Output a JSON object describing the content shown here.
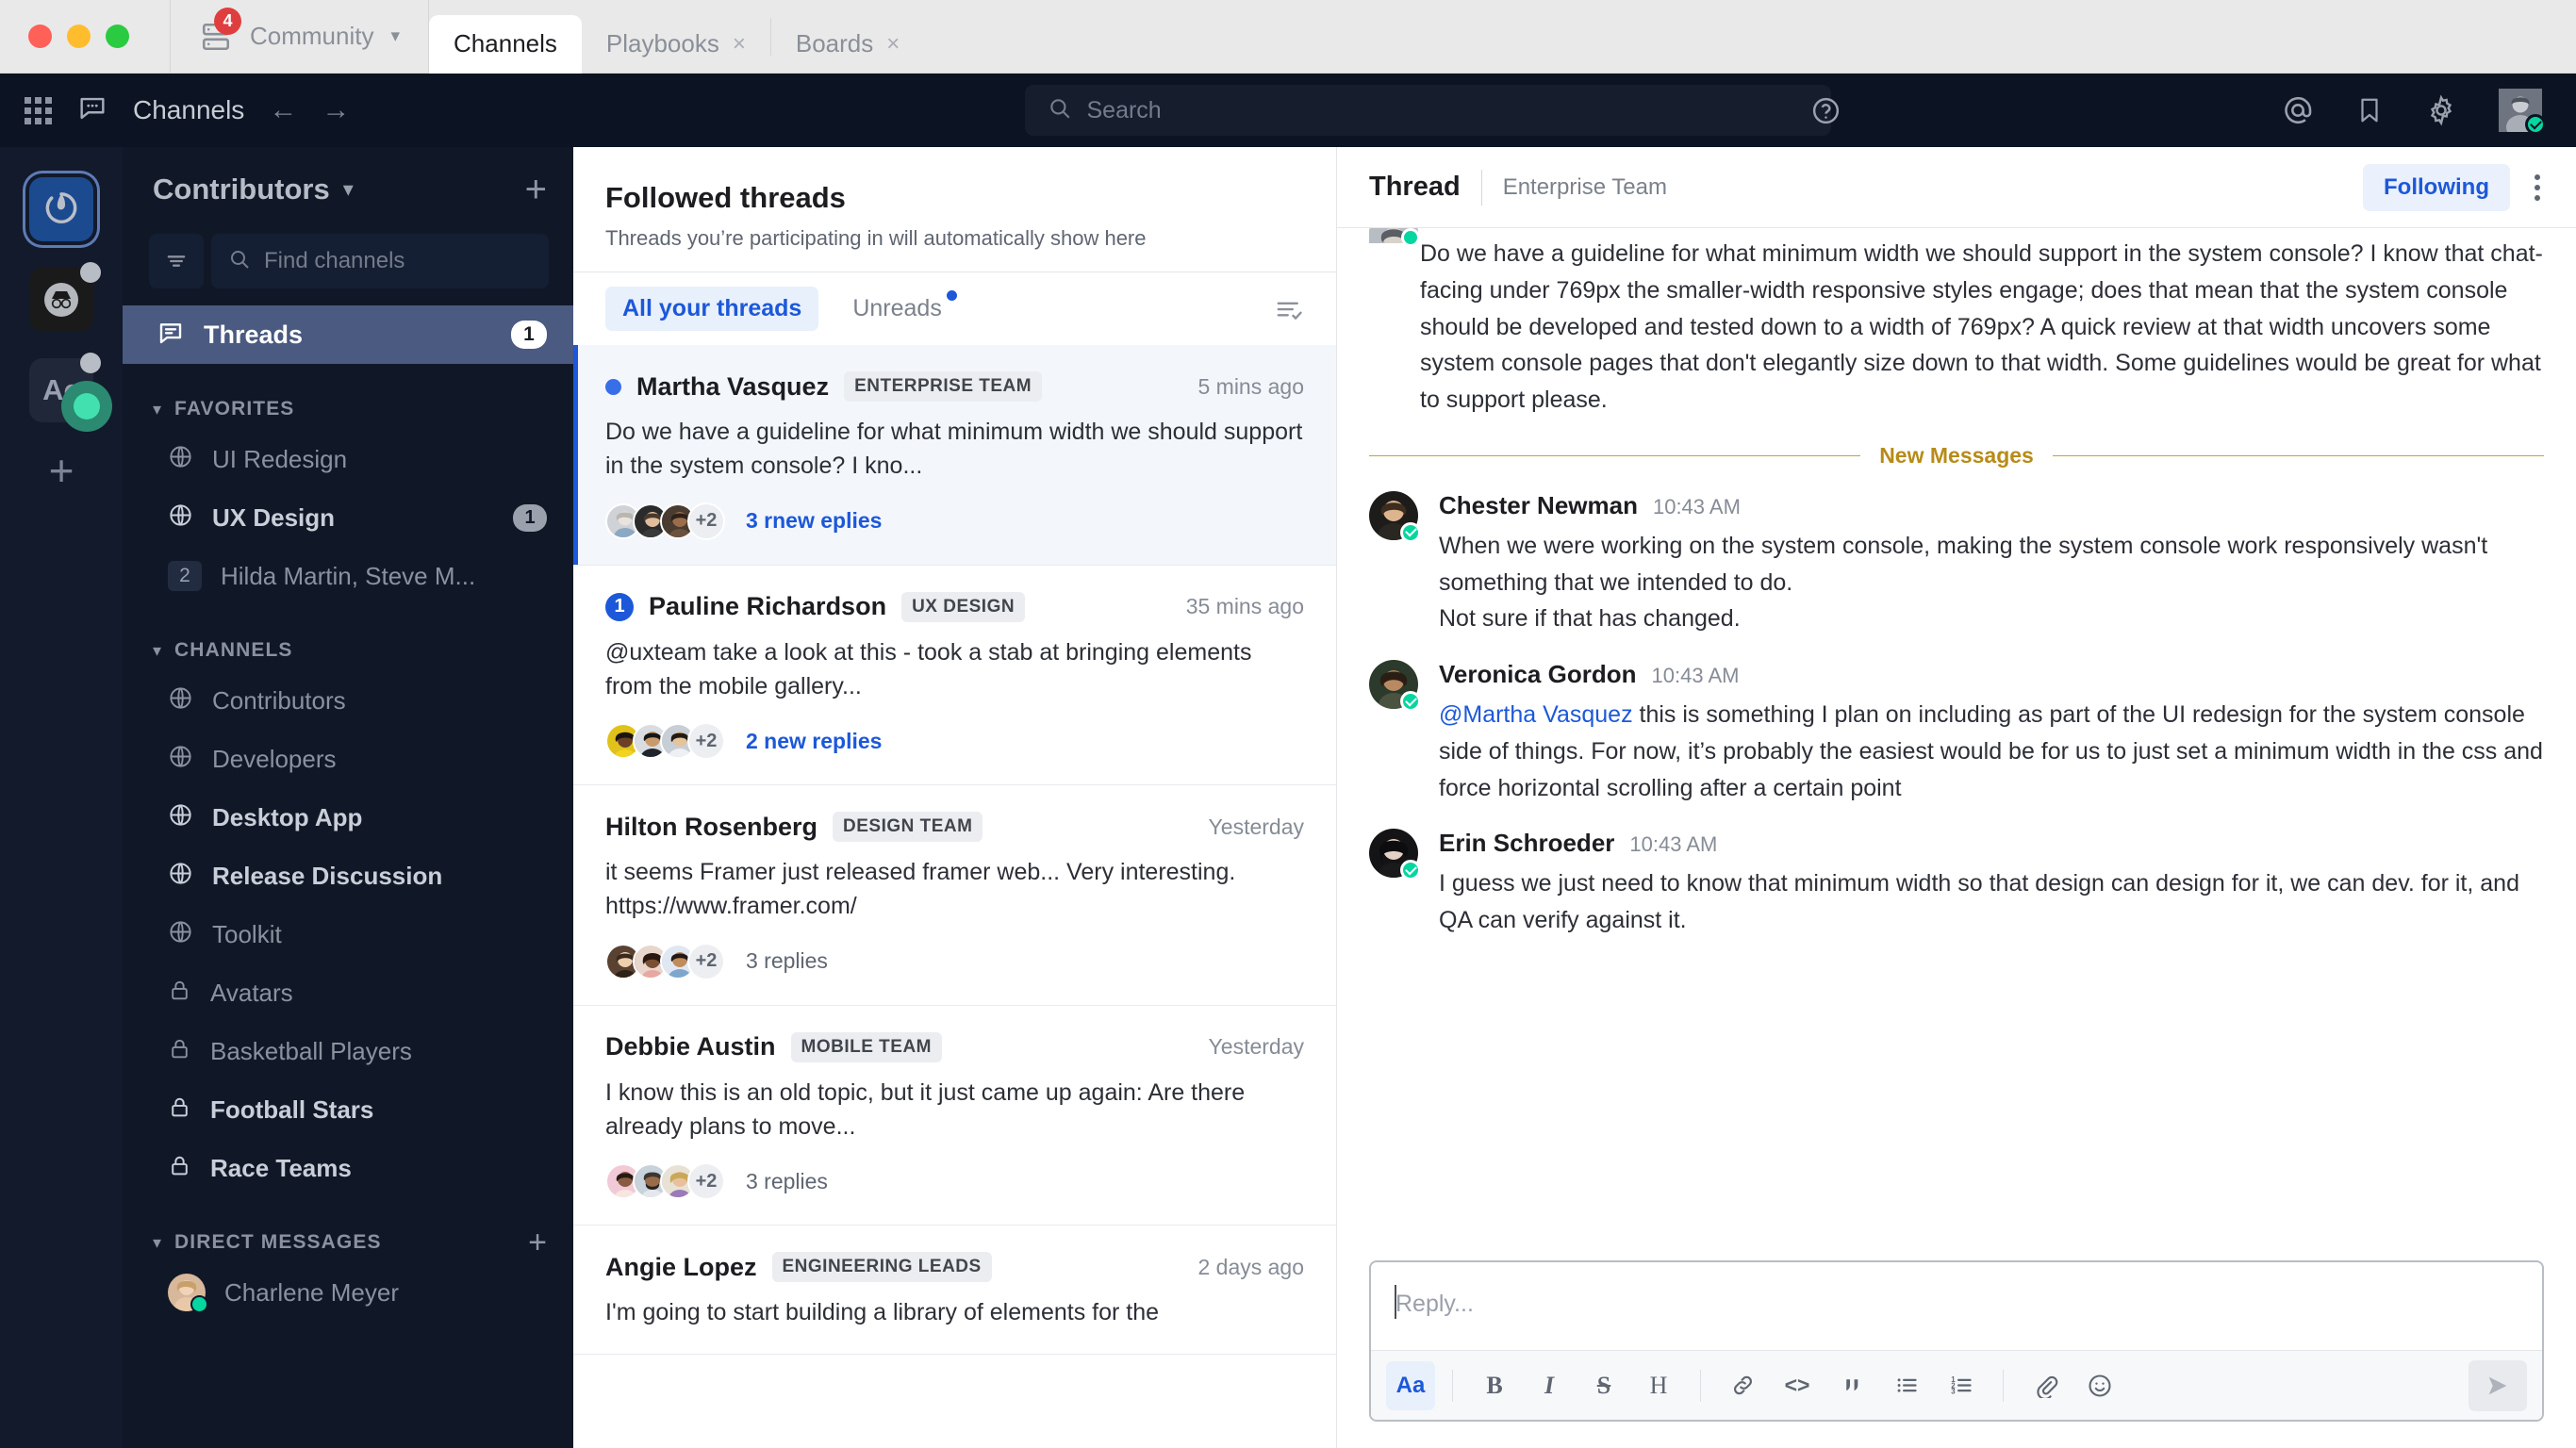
{
  "titlebar": {
    "team_switcher": {
      "name": "Community",
      "badge": "4",
      "chevron": "chevron-down-icon"
    },
    "tabs": [
      {
        "label": "Channels",
        "active": true,
        "closable": false
      },
      {
        "label": "Playbooks",
        "active": false,
        "closable": true
      },
      {
        "label": "Boards",
        "active": false,
        "closable": true
      }
    ],
    "close_glyph": "×"
  },
  "global_header": {
    "product_title": "Channels",
    "back_glyph": "←",
    "forward_glyph": "→",
    "search_placeholder": "Search",
    "icons": [
      "grid-icon",
      "channels-icon",
      "help-icon",
      "at-mention-icon",
      "saved-posts-icon",
      "settings-gear-icon",
      "user-avatar"
    ]
  },
  "team_sidebar": {
    "teams": [
      {
        "name": "Mattermost",
        "selected": true,
        "unread": false
      },
      {
        "name": "Incognito",
        "selected": false,
        "unread": true
      },
      {
        "name": "Ac",
        "initials": "Ac",
        "selected": false,
        "unread": true
      }
    ],
    "add_label": "+"
  },
  "channel_sidebar": {
    "team_name": "Contributors",
    "add_channel_glyph": "+",
    "find_placeholder": "Find channels",
    "threads": {
      "label": "Threads",
      "count": "1"
    },
    "groups": [
      {
        "title": "FAVORITES",
        "has_add": false,
        "items": [
          {
            "label": "UI Redesign",
            "icon": "globe-icon",
            "unread": false,
            "badge": ""
          },
          {
            "label": "UX Design",
            "icon": "globe-icon",
            "unread": true,
            "badge": "1"
          },
          {
            "label": "Hilda Martin, Steve M...",
            "icon": "dm-count",
            "unread": false,
            "badge": "",
            "dm_count": "2"
          }
        ]
      },
      {
        "title": "CHANNELS",
        "has_add": false,
        "items": [
          {
            "label": "Contributors",
            "icon": "globe-icon",
            "unread": false,
            "badge": ""
          },
          {
            "label": "Developers",
            "icon": "globe-icon",
            "unread": false,
            "badge": ""
          },
          {
            "label": "Desktop App",
            "icon": "globe-icon",
            "unread": true,
            "badge": ""
          },
          {
            "label": "Release Discussion",
            "icon": "globe-icon",
            "unread": true,
            "badge": ""
          },
          {
            "label": "Toolkit",
            "icon": "globe-icon",
            "unread": false,
            "badge": ""
          },
          {
            "label": "Avatars",
            "icon": "lock-icon",
            "unread": false,
            "badge": ""
          },
          {
            "label": "Basketball Players",
            "icon": "lock-icon",
            "unread": false,
            "badge": ""
          },
          {
            "label": "Football Stars",
            "icon": "lock-icon",
            "unread": true,
            "badge": ""
          },
          {
            "label": "Race Teams",
            "icon": "lock-icon",
            "unread": true,
            "badge": ""
          }
        ]
      },
      {
        "title": "DIRECT MESSAGES",
        "has_add": true,
        "items": [
          {
            "label": "Charlene Meyer",
            "icon": "dm-avatar",
            "unread": false,
            "badge": "",
            "status": "online"
          }
        ]
      }
    ]
  },
  "threads_panel": {
    "title": "Followed threads",
    "subtitle": "Threads you’re participating in will automatically show here",
    "tabs": [
      {
        "label": "All your threads",
        "active": true,
        "has_dot": false
      },
      {
        "label": "Unreads",
        "active": false,
        "has_dot": true
      }
    ],
    "mark_all_read_icon": "mark-all-read-icon",
    "items": [
      {
        "author": "Martha Vasquez",
        "channel": "ENTERPRISE TEAM",
        "time": "5 mins ago",
        "preview": "Do we have a guideline for what minimum width we should support in the system console? I kno...",
        "replies_label": "3 rnew eplies",
        "replies_unread": true,
        "extra_participants": "+2",
        "indicator": "dot",
        "indicator_value": "",
        "selected": true
      },
      {
        "author": "Pauline Richardson",
        "channel": "UX DESIGN",
        "time": "35 mins ago",
        "preview": "@uxteam take a look at this - took a stab at bringing elements from the mobile gallery...",
        "replies_label": "2 new replies",
        "replies_unread": true,
        "extra_participants": "+2",
        "indicator": "badge",
        "indicator_value": "1",
        "selected": false
      },
      {
        "author": "Hilton Rosenberg",
        "channel": "DESIGN TEAM",
        "time": "Yesterday",
        "preview": "it seems Framer just released framer web... Very interesting. https://www.framer.com/",
        "replies_label": "3 replies",
        "replies_unread": false,
        "extra_participants": "+2",
        "indicator": "none",
        "indicator_value": "",
        "selected": false
      },
      {
        "author": "Debbie Austin",
        "channel": "MOBILE TEAM",
        "time": "Yesterday",
        "preview": "I know this is an old topic, but it just came up again: Are there already plans to move...",
        "replies_label": "3 replies",
        "replies_unread": false,
        "extra_participants": "+2",
        "indicator": "none",
        "indicator_value": "",
        "selected": false
      },
      {
        "author": "Angie Lopez",
        "channel": "ENGINEERING LEADS",
        "time": "2 days ago",
        "preview": "I'm going to start building a library of elements for the",
        "replies_label": "",
        "replies_unread": false,
        "extra_participants": "",
        "indicator": "none",
        "indicator_value": "",
        "selected": false
      }
    ]
  },
  "thread_view": {
    "title": "Thread",
    "channel": "Enterprise Team",
    "following_label": "Following",
    "kebab_icon": "more-options-icon",
    "root_message": "Do we have a guideline for what minimum width we should support in the system console? I know that chat-facing under 769px the smaller-width responsive styles engage; does that mean that the system console should be developed and tested down to a width of 769px? A quick review at that width uncovers some system console pages that don't elegantly size down to that width. Some guidelines would be great for what to support please.",
    "new_messages_label": "New Messages",
    "messages": [
      {
        "author": "Chester Newman",
        "time": "10:43 AM",
        "text": "When we were working on the system console, making the system console work responsively wasn't something that we intended to do.\nNot sure if that has changed.",
        "mention": "",
        "status": "online"
      },
      {
        "author": "Veronica Gordon",
        "time": "10:43 AM",
        "mention": "@Martha Vasquez",
        "text": " this is something I plan on including as part of the UI redesign for the system console side of things. For now, it’s probably the easiest would be for us to just set a minimum width in the css and force horizontal scrolling after a certain point",
        "status": "online"
      },
      {
        "author": "Erin Schroeder",
        "time": "10:43 AM",
        "mention": "",
        "text": "I guess we just need to know that minimum width so that design can design for it, we can dev. for it, and QA can verify against it.",
        "status": "online"
      }
    ],
    "reply_placeholder": "Reply...",
    "format_buttons": [
      {
        "name": "toggle-formatting",
        "glyph": "Aa"
      },
      {
        "name": "bold",
        "glyph": "B"
      },
      {
        "name": "italic",
        "glyph": "I"
      },
      {
        "name": "strikethrough",
        "glyph": "S"
      },
      {
        "name": "heading",
        "glyph": "H"
      },
      {
        "name": "link",
        "glyph": "link"
      },
      {
        "name": "code",
        "glyph": "<>"
      },
      {
        "name": "quote",
        "glyph": "quote"
      },
      {
        "name": "bulleted-list",
        "glyph": "ul"
      },
      {
        "name": "numbered-list",
        "glyph": "ol"
      },
      {
        "name": "attach-file",
        "glyph": "paperclip"
      },
      {
        "name": "emoji",
        "glyph": "emoji"
      }
    ],
    "send_label": "send-icon"
  },
  "colors": {
    "accent_blue": "#1c58d9",
    "sidebar_bg": "#101828",
    "header_bg": "#0c1322",
    "new_messages": "#b88b18",
    "online_green": "#06d6a0",
    "unread_red": "#e03e3e"
  }
}
